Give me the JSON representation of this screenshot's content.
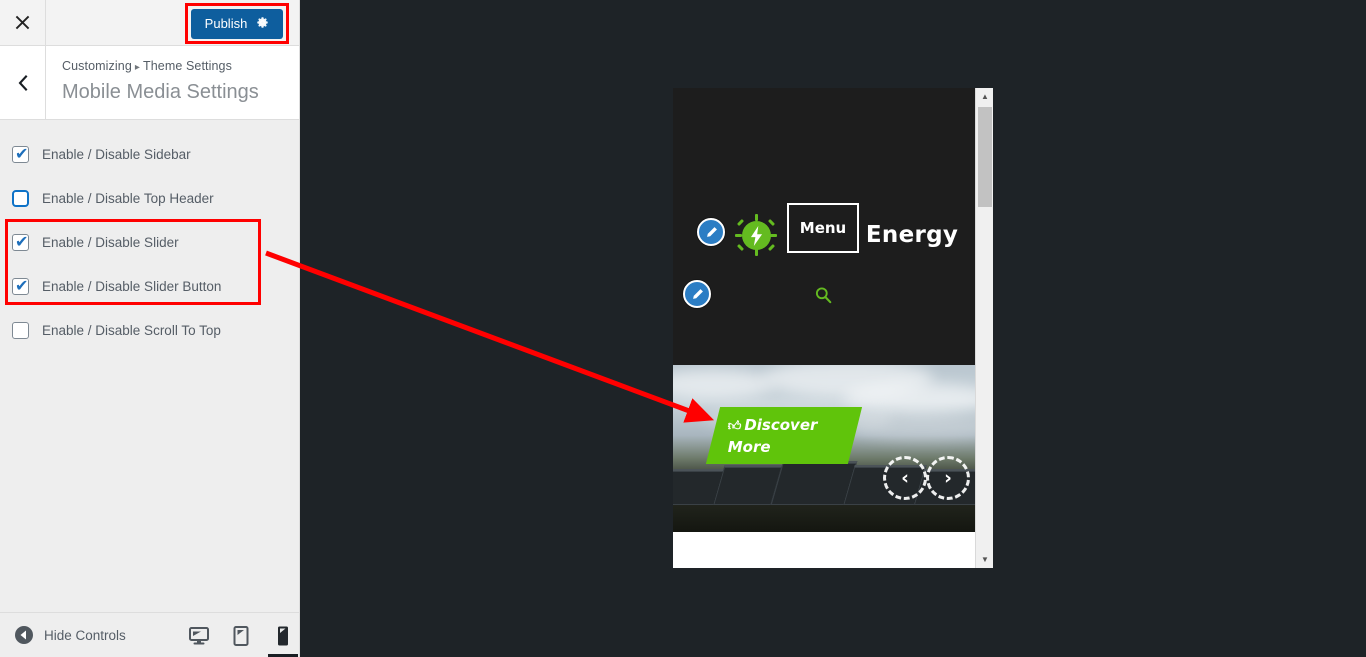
{
  "customizer": {
    "close_icon": "close-icon",
    "publish": {
      "label": "Publish",
      "gear_icon": "gear-icon",
      "color": "#0e5e9e",
      "highlight_color": "#ff0000"
    },
    "back_icon": "chevron-left-icon",
    "breadcrumb": {
      "root": "Customizing",
      "separator": "▸",
      "parent": "Theme Settings"
    },
    "panel_title": "Mobile Media Settings",
    "controls": [
      {
        "label": "Enable / Disable Sidebar",
        "checked": true,
        "focused": false
      },
      {
        "label": "Enable / Disable Top Header",
        "checked": false,
        "focused": true
      },
      {
        "label": "Enable / Disable Slider",
        "checked": true,
        "focused": false
      },
      {
        "label": "Enable / Disable Slider Button",
        "checked": true,
        "focused": false
      },
      {
        "label": "Enable / Disable Scroll To Top",
        "checked": false,
        "focused": false
      }
    ],
    "check_glyph": "✔",
    "footer": {
      "hide_controls_label": "Hide Controls",
      "hide_controls_icon": "collapse-left-icon",
      "devices": [
        {
          "name": "desktop",
          "icon": "desktop-icon",
          "active": false
        },
        {
          "name": "tablet",
          "icon": "tablet-icon",
          "active": false
        },
        {
          "name": "mobile",
          "icon": "mobile-icon",
          "active": true
        }
      ]
    }
  },
  "preview": {
    "background": "#1e2327",
    "site": {
      "brand_name": "Solar Energy",
      "logo_icon": "sun-bolt-logo-icon",
      "accent_color": "#64bb20",
      "menu_label": "Menu",
      "search_icon": "search-icon",
      "edit_pins": [
        {
          "name": "edit-logo-pin",
          "icon": "pencil-icon"
        },
        {
          "name": "edit-search-pin",
          "icon": "pencil-icon"
        }
      ],
      "slider": {
        "button_label_line1": "Discover",
        "button_label_line2": "More",
        "button_icon": "thumbs-up-icon",
        "button_color": "#60c40b",
        "prev_icon": "chevron-left-icon",
        "next_icon": "chevron-right-icon",
        "prev_glyph": "‹",
        "next_glyph": "›"
      }
    },
    "scrollbar": {
      "up_glyph": "▲",
      "down_glyph": "▼"
    }
  },
  "annotation": {
    "arrow_color": "#ff0000",
    "box_color": "#ff0000"
  }
}
